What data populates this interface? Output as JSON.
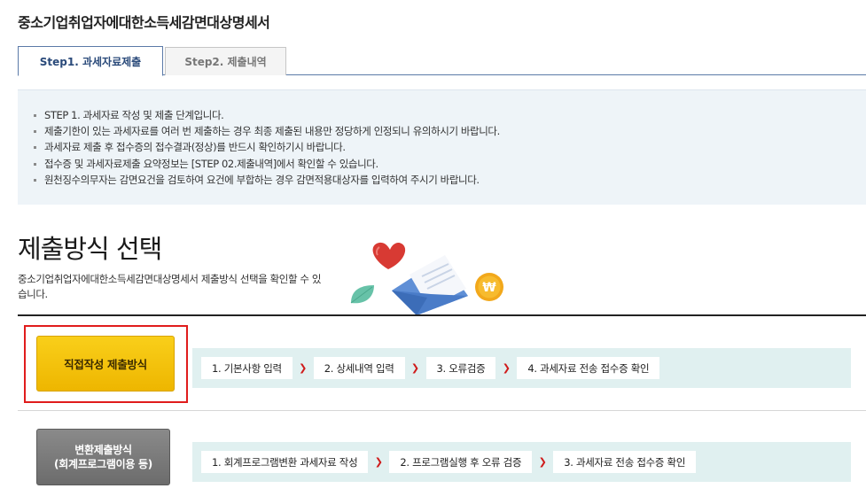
{
  "page": {
    "title": "중소기업취업자에대한소득세감면대상명세서"
  },
  "tabs": [
    {
      "label": "Step1. 과세자료제출",
      "active": true
    },
    {
      "label": "Step2. 제출내역",
      "active": false
    }
  ],
  "notice": {
    "items": [
      "STEP 1. 과세자료 작성 및 제출 단계입니다.",
      "제출기한이 있는 과세자료를 여러 번 제출하는 경우 최종 제출된 내용만 정당하게 인정되니 유의하시기 바랍니다.",
      "과세자료 제출 후 접수증의 접수결과(정상)를 반드시 확인하기시 바랍니다.",
      "접수증 및 과세자료제출 요약정보는 [STEP 02.제출내역]에서 확인할 수 있습니다.",
      "원천징수의무자는 감면요건을 검토하여 요건에 부합하는 경우 감면적용대상자를 입력하여 주시기 바랍니다."
    ]
  },
  "section": {
    "title": "제출방식 선택",
    "description": "중소기업취업자에대한소득세감면대상명세서 제출방식 선택을 확인할 수 있습니다."
  },
  "illustration": {
    "coin_symbol": "₩",
    "icons": [
      "heart-icon",
      "envelope-icon",
      "coin-icon",
      "leaf-icon"
    ]
  },
  "methods": {
    "direct": {
      "label": "직접작성 제출방식",
      "selected": true,
      "steps": [
        "1. 기본사항 입력",
        "2. 상세내역 입력",
        "3. 오류검증",
        "4. 과세자료 전송 접수증 확인"
      ]
    },
    "convert": {
      "label_line1": "변환제출방식",
      "label_line2": "(회계프로그램이용 등)",
      "steps": [
        "1. 회계프로그램변환 과세자료 작성",
        "2. 프로그램실행 후 오류 검증",
        "3. 과세자료 전송 접수증 확인"
      ]
    }
  },
  "colors": {
    "accent_blue": "#5b7aa8",
    "highlight_red": "#e01c1c",
    "button_yellow": "#f5c30c",
    "button_gray": "#777777",
    "flow_bg": "#e0f0f0",
    "notice_bg": "#eef4f8"
  }
}
